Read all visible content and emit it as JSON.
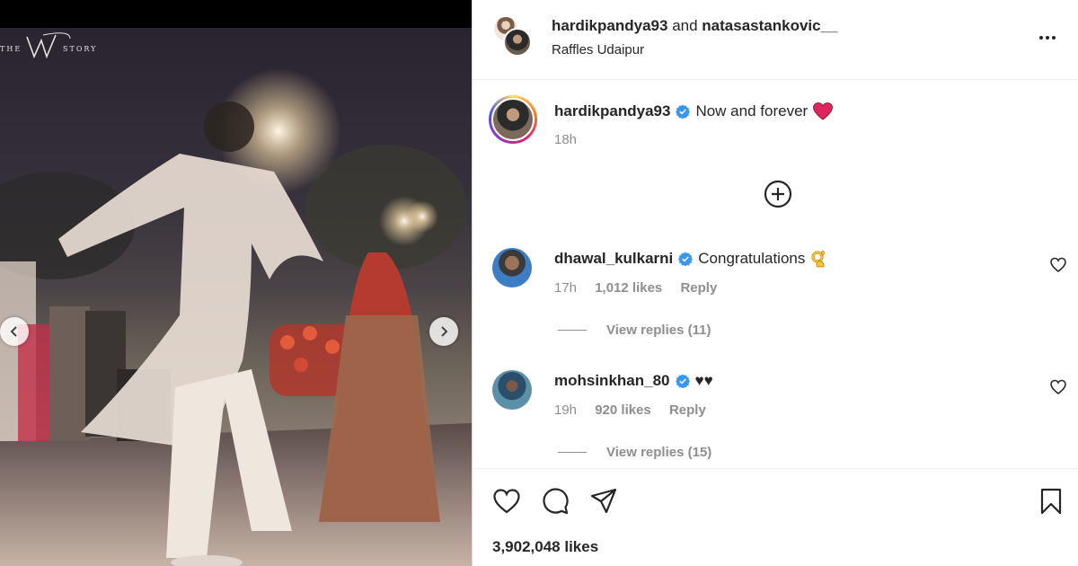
{
  "watermark": {
    "brand": "THE W STORY"
  },
  "media": {
    "prev_icon": "chevron-left-icon",
    "next_icon": "chevron-right-icon"
  },
  "header": {
    "user1": "hardikpandya93",
    "joiner": "and",
    "user2": "natasastankovic__",
    "location": "Raffles Udaipur",
    "more_icon": "more-horizontal-icon"
  },
  "caption": {
    "username": "hardikpandya93",
    "text": "Now and forever",
    "emoji": "red-heart-emoji",
    "time": "18h"
  },
  "load_more_icon": "plus-circle-icon",
  "comments": [
    {
      "username": "dhawal_kulkarni",
      "text": "Congratulations",
      "emoji": "ok-hand-emoji",
      "time": "17h",
      "likes": "1,012 likes",
      "reply": "Reply",
      "view_replies": "View replies (11)"
    },
    {
      "username": "mohsinkhan_80",
      "text": "♥♥",
      "time": "19h",
      "likes": "920 likes",
      "reply": "Reply",
      "view_replies": "View replies (15)"
    }
  ],
  "actions": {
    "like_icon": "heart-icon",
    "comment_icon": "comment-icon",
    "share_icon": "paper-plane-icon",
    "save_icon": "bookmark-icon",
    "likes": "3,902,048 likes"
  },
  "colors": {
    "verified": "#3897f0",
    "meta_text": "#8e8e8e",
    "heart_red": "#e0245e",
    "story_ring": "#d62976"
  }
}
